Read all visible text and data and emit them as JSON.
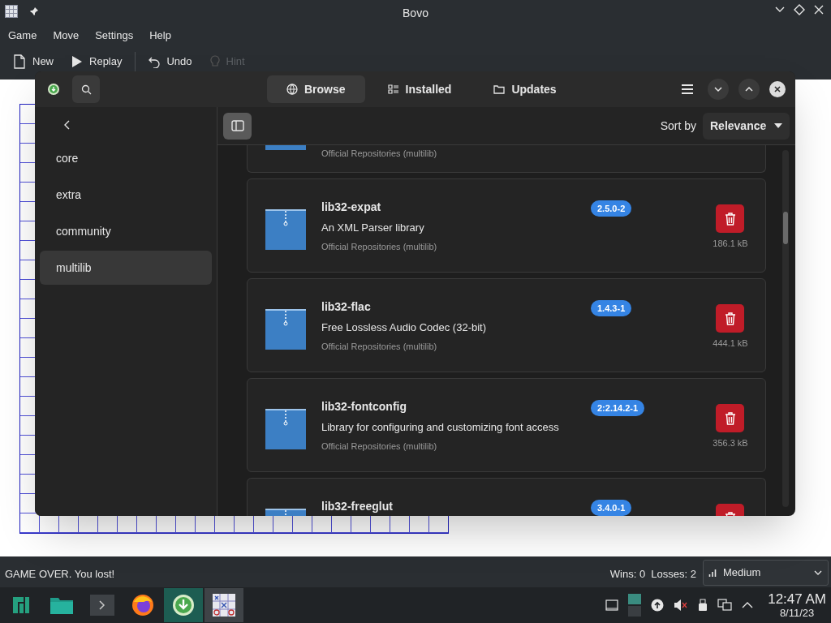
{
  "bovo": {
    "title": "Bovo",
    "menu": [
      "Game",
      "Move",
      "Settings",
      "Help"
    ],
    "toolbar": [
      {
        "kind": "new",
        "label": "New",
        "disabled": false
      },
      {
        "kind": "replay",
        "label": "Replay",
        "disabled": false
      },
      {
        "kind": "undo",
        "label": "Undo",
        "disabled": false
      },
      {
        "kind": "hint",
        "label": "Hint",
        "disabled": true
      }
    ],
    "status": "GAME OVER. You lost!",
    "score": "Wins: 0  Losses: 2",
    "difficulty": "Medium"
  },
  "pamac": {
    "tabs": [
      {
        "kind": "browse",
        "label": "Browse",
        "selected": true
      },
      {
        "kind": "installed",
        "label": "Installed",
        "selected": false
      },
      {
        "kind": "updates",
        "label": "Updates",
        "selected": false
      }
    ],
    "sidebar": [
      {
        "label": "core",
        "selected": false
      },
      {
        "label": "extra",
        "selected": false
      },
      {
        "label": "community",
        "selected": false
      },
      {
        "label": "multilib",
        "selected": true
      }
    ],
    "sort_label": "Sort by",
    "sort_value": "Relevance",
    "packages": [
      {
        "kind": "tail",
        "repo": "Official Repositories (multilib)"
      },
      {
        "kind": "full",
        "name": "lib32-expat",
        "description": "An XML Parser library",
        "repo": "Official Repositories (multilib)",
        "version": "2.5.0-2",
        "size": "186.1 kB"
      },
      {
        "kind": "full",
        "name": "lib32-flac",
        "description": "Free Lossless Audio Codec (32-bit)",
        "repo": "Official Repositories (multilib)",
        "version": "1.4.3-1",
        "size": "444.1 kB"
      },
      {
        "kind": "full",
        "name": "lib32-fontconfig",
        "description": "Library for configuring and customizing font access",
        "repo": "Official Repositories (multilib)",
        "version": "2:2.14.2-1",
        "size": "356.3 kB"
      },
      {
        "kind": "head",
        "name": "lib32-freeglut",
        "version": "3.4.0-1"
      }
    ]
  },
  "taskbar": {
    "items": [
      {
        "kind": "start",
        "open": false,
        "selected": false
      },
      {
        "kind": "files",
        "open": false,
        "selected": false
      },
      {
        "kind": "terminal",
        "open": false,
        "selected": false
      },
      {
        "kind": "browser",
        "open": false,
        "selected": false
      },
      {
        "kind": "pamac",
        "open": true,
        "selected": true
      },
      {
        "kind": "bovo",
        "open": true,
        "selected": false
      }
    ],
    "time": "12:47 AM",
    "date": "8/11/23"
  }
}
